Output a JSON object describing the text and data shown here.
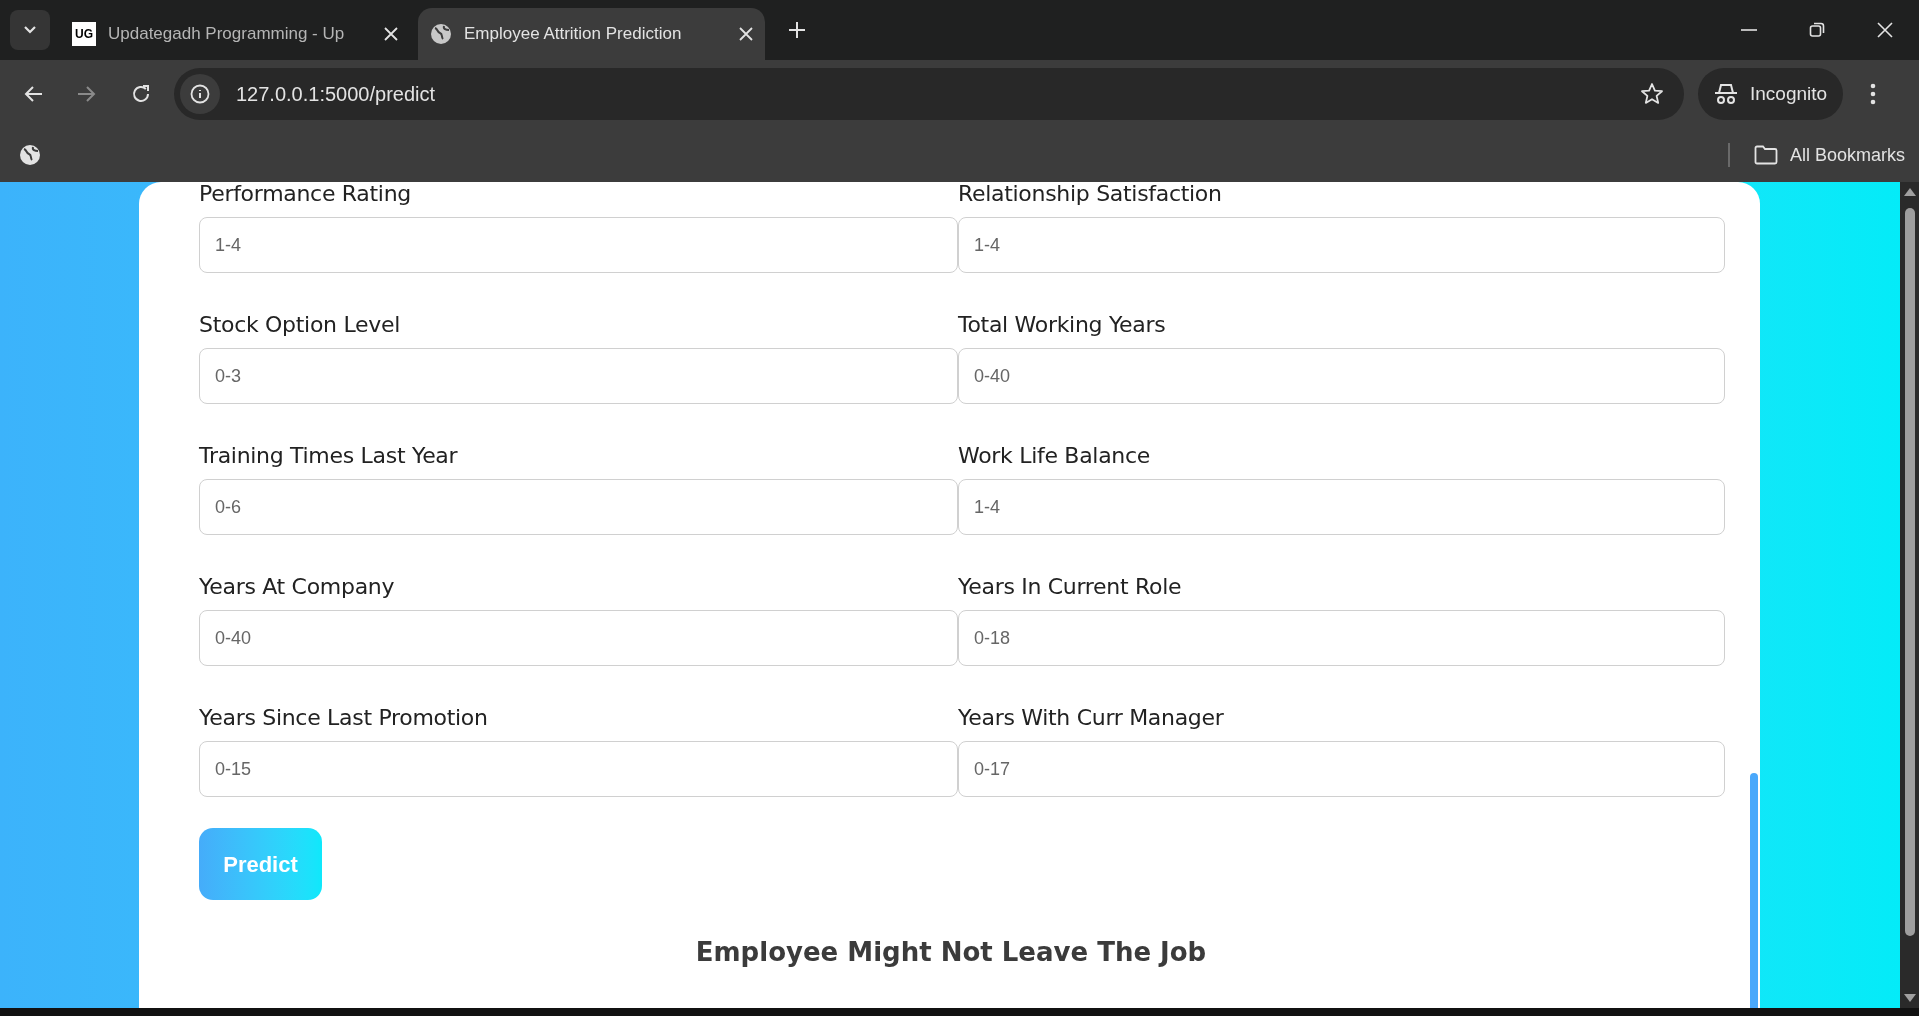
{
  "browser": {
    "tabs": [
      {
        "title": "Updategadh Programming - Up",
        "favicon": "UG",
        "selected": false
      },
      {
        "title": "Employee Attrition Prediction",
        "selected": true
      }
    ],
    "address": "127.0.0.1:5000/predict",
    "profile": "Incognito",
    "bookmarks_folder": "All Bookmarks"
  },
  "form": {
    "fields": [
      {
        "label": "Performance Rating",
        "placeholder": "1-4"
      },
      {
        "label": "Relationship Satisfaction",
        "placeholder": "1-4"
      },
      {
        "label": "Stock Option Level",
        "placeholder": "0-3"
      },
      {
        "label": "Total Working Years",
        "placeholder": "0-40"
      },
      {
        "label": "Training Times Last Year",
        "placeholder": "0-6"
      },
      {
        "label": "Work Life Balance",
        "placeholder": "1-4"
      },
      {
        "label": "Years At Company",
        "placeholder": "0-40"
      },
      {
        "label": "Years In Current Role",
        "placeholder": "0-18"
      },
      {
        "label": "Years Since Last Promotion",
        "placeholder": "0-15"
      },
      {
        "label": "Years With Curr Manager",
        "placeholder": "0-17"
      }
    ],
    "submit": "Predict"
  },
  "result": "Employee Might Not Leave The Job"
}
